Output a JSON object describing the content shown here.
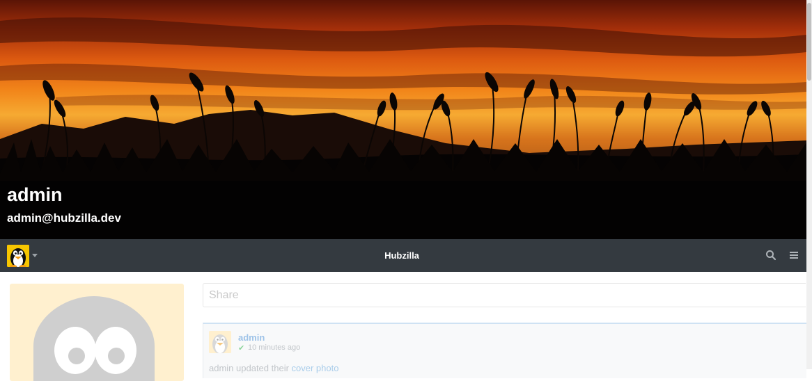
{
  "cover": {
    "name": "admin",
    "address": "admin@hubzilla.dev"
  },
  "navbar": {
    "title": "Hubzilla",
    "avatar_icon": "penguin-avatar-icon",
    "search_icon": "search-icon",
    "menu_icon": "hamburger-menu-icon"
  },
  "share": {
    "placeholder": "Share"
  },
  "post": {
    "author": "admin",
    "time": "10 minutes ago",
    "body_prefix": "admin updated their ",
    "body_link": "cover photo"
  },
  "colors": {
    "navbar": "#343a40",
    "link": "#a9cdea",
    "profile_bg": "#fff0cf"
  }
}
